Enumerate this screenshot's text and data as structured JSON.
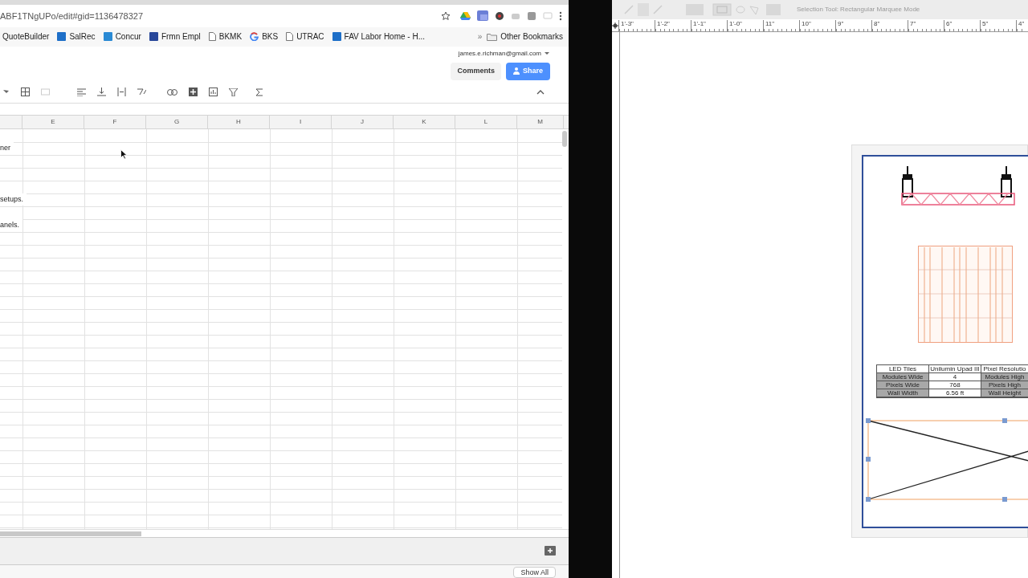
{
  "browser": {
    "url": "ABF1TNgUPo/edit#gid=1136478327",
    "bookmarks": [
      {
        "label": "QuoteBuilder",
        "kind": "none"
      },
      {
        "label": "SalRec",
        "kind": "square",
        "color": "#1e6fc8"
      },
      {
        "label": "Concur",
        "kind": "square",
        "color": "#2a8ad4"
      },
      {
        "label": "Frmn Empl",
        "kind": "square",
        "color": "#28479a"
      },
      {
        "label": "BKMK",
        "kind": "page"
      },
      {
        "label": "BKS",
        "kind": "google"
      },
      {
        "label": "UTRAC",
        "kind": "page"
      },
      {
        "label": "FAV Labor Home - H...",
        "kind": "square",
        "color": "#1e6fc8"
      }
    ],
    "overflow": "»",
    "other_bookmarks": "Other Bookmarks"
  },
  "sheet": {
    "account": "james.e.richman@gmail.com",
    "comments": "Comments",
    "share": "Share",
    "columns": [
      "E",
      "F",
      "G",
      "H",
      "I",
      "J",
      "K",
      "L",
      "M"
    ],
    "rows": [
      {},
      {
        "column_d": "ner"
      },
      {},
      {},
      {},
      {
        "column_d": "setups."
      },
      {},
      {
        "column_d": "anels."
      }
    ],
    "show_all": "Show All"
  },
  "cad": {
    "status": "Selection Tool: Rectangular Marquee Mode",
    "ruler": [
      "1'-3\"",
      "1'-2\"",
      "1'-1\"",
      "1'-0\"",
      "11\"",
      "10\"",
      "9\"",
      "8\"",
      "7\"",
      "6\"",
      "5\"",
      "4\""
    ],
    "table": [
      [
        "LED Tiles",
        "Unilumin Upad III",
        "Pixel Resolutio"
      ],
      [
        "Modules Wide",
        "4",
        "Modules High"
      ],
      [
        "Pixels Wide",
        "768",
        "Pixels High"
      ],
      [
        "Wall Width",
        "6.56 ft",
        "Wall Height"
      ]
    ]
  }
}
